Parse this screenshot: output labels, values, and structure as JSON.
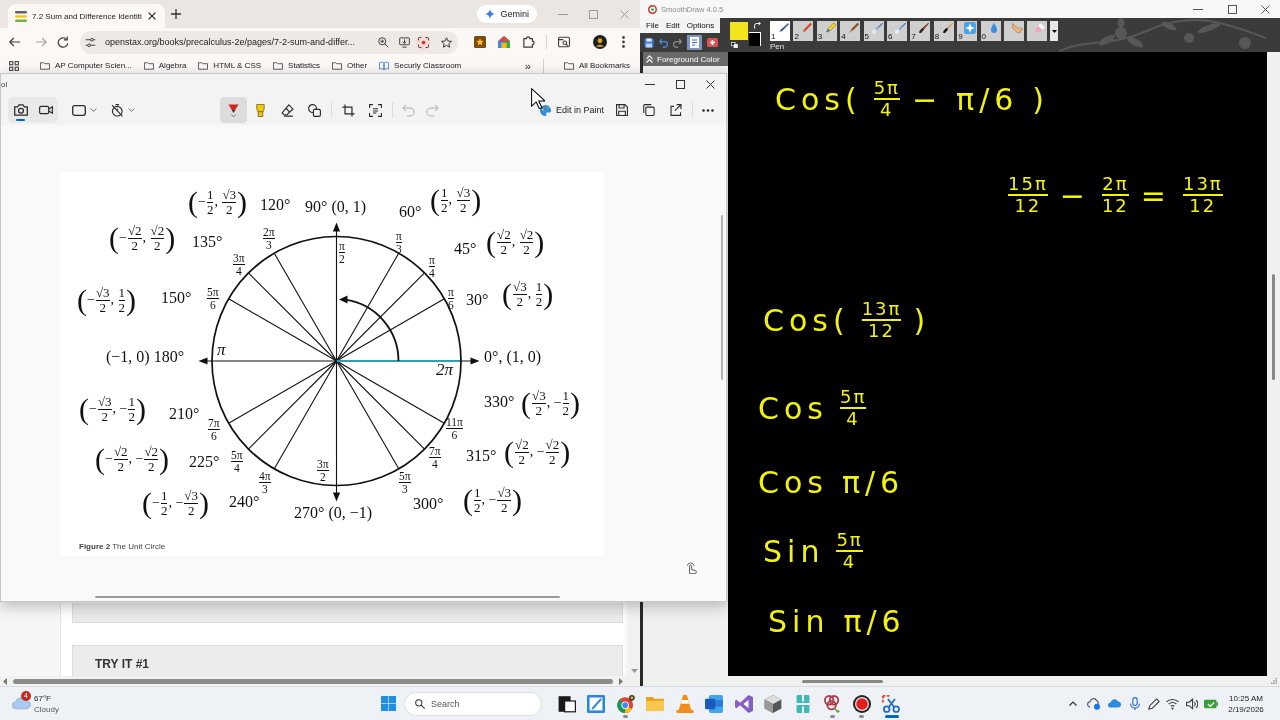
{
  "browser": {
    "tab": {
      "title": "7.2 Sum and Difference Identiti"
    },
    "assistant_button": "Gemini",
    "url": "openstax.org/books/precalculus-2e/pages/7-2-sum-and-differ...",
    "bookmarks": [
      {
        "kind": "folder",
        "label": "AP Computer Scien..."
      },
      {
        "kind": "folder",
        "label": "Algebra"
      },
      {
        "kind": "folder",
        "label": "HTML & CSS"
      },
      {
        "kind": "folder",
        "label": "Statistics"
      },
      {
        "kind": "folder",
        "label": "Other"
      },
      {
        "kind": "site",
        "label": "Securly Classroom"
      }
    ],
    "more_bookmarks": "»",
    "all_bookmarks": "All Bookmarks",
    "page": {
      "box_heading": "TRY IT #1"
    }
  },
  "snipping_tool": {
    "title": "ol",
    "modes": [
      {
        "kind": "photo",
        "selected": true
      },
      {
        "kind": "video",
        "selected": false
      }
    ],
    "tools": [
      {
        "kind": "pen",
        "selected": true
      },
      {
        "kind": "highlighter",
        "selected": false
      },
      {
        "kind": "eraser",
        "selected": false
      },
      {
        "kind": "shapes",
        "selected": false
      }
    ],
    "history": [
      {
        "kind": "undo",
        "disabled": true
      },
      {
        "kind": "redo",
        "disabled": true
      }
    ],
    "edit_in_paint": "Edit in Paint",
    "figure": {
      "labels": [
        {
          "kind": "coordinate",
          "parts": [
            {
              "kind": "paren",
              "text": "("
            },
            {
              "kind": "text",
              "text": "−"
            },
            {
              "kind": "fraction",
              "num": "1",
              "den": "2"
            },
            {
              "kind": "text",
              "text": ", "
            },
            {
              "kind": "fraction",
              "num": "√3",
              "den": "2"
            },
            {
              "kind": "paren",
              "text": ")"
            }
          ]
        },
        {
          "kind": "degree",
          "text": "120°"
        },
        {
          "kind": "degree",
          "text": "90° (0, 1)"
        },
        {
          "kind": "degree",
          "text": "60°"
        },
        {
          "kind": "coordinate",
          "parts": [
            {
              "kind": "paren",
              "text": "("
            },
            {
              "kind": "fraction",
              "num": "1",
              "den": "2"
            },
            {
              "kind": "text",
              "text": ", "
            },
            {
              "kind": "fraction",
              "num": "√3",
              "den": "2"
            },
            {
              "kind": "paren",
              "text": ")"
            }
          ]
        },
        {
          "kind": "coordinate",
          "parts": [
            {
              "kind": "paren",
              "text": "("
            },
            {
              "kind": "text",
              "text": "−"
            },
            {
              "kind": "fraction",
              "num": "√2",
              "den": "2"
            },
            {
              "kind": "text",
              "text": ", "
            },
            {
              "kind": "fraction",
              "num": "√2",
              "den": "2"
            },
            {
              "kind": "paren",
              "text": ")"
            }
          ]
        },
        {
          "kind": "degree",
          "text": "135°"
        },
        {
          "kind": "radian",
          "parts": [
            {
              "kind": "fraction",
              "num": "2π",
              "den": "3"
            }
          ]
        },
        {
          "kind": "radian",
          "parts": [
            {
              "kind": "fraction",
              "num": "π",
              "den": "2"
            }
          ]
        },
        {
          "kind": "radian",
          "parts": [
            {
              "kind": "fraction",
              "num": "π",
              "den": "3"
            }
          ]
        },
        {
          "kind": "radian",
          "parts": [
            {
              "kind": "fraction",
              "num": "π",
              "den": "4"
            }
          ]
        },
        {
          "kind": "degree",
          "text": "45°"
        },
        {
          "kind": "coordinate",
          "parts": [
            {
              "kind": "paren",
              "text": "("
            },
            {
              "kind": "fraction",
              "num": "√2",
              "den": "2"
            },
            {
              "kind": "text",
              "text": ", "
            },
            {
              "kind": "fraction",
              "num": "√2",
              "den": "2"
            },
            {
              "kind": "paren",
              "text": ")"
            }
          ]
        },
        {
          "kind": "radian",
          "parts": [
            {
              "kind": "fraction",
              "num": "3π",
              "den": "4"
            }
          ]
        },
        {
          "kind": "coordinate",
          "parts": [
            {
              "kind": "paren",
              "text": "("
            },
            {
              "kind": "text",
              "text": "−"
            },
            {
              "kind": "fraction",
              "num": "√3",
              "den": "2"
            },
            {
              "kind": "text",
              "text": ", "
            },
            {
              "kind": "fraction",
              "num": "1",
              "den": "2"
            },
            {
              "kind": "paren",
              "text": ")"
            }
          ]
        },
        {
          "kind": "degree",
          "text": "150°"
        },
        {
          "kind": "radian",
          "parts": [
            {
              "kind": "fraction",
              "num": "5π",
              "den": "6"
            }
          ]
        },
        {
          "kind": "radian",
          "parts": [
            {
              "kind": "fraction",
              "num": "π",
              "den": "6"
            }
          ]
        },
        {
          "kind": "degree",
          "text": "30°"
        },
        {
          "kind": "coordinate",
          "parts": [
            {
              "kind": "paren",
              "text": "("
            },
            {
              "kind": "fraction",
              "num": "√3",
              "den": "2"
            },
            {
              "kind": "text",
              "text": ", "
            },
            {
              "kind": "fraction",
              "num": "1",
              "den": "2"
            },
            {
              "kind": "paren",
              "text": ")"
            }
          ]
        },
        {
          "kind": "degree",
          "text": "(−1, 0) 180°"
        },
        {
          "kind": "radian",
          "parts": [
            {
              "kind": "text",
              "text": "π"
            }
          ]
        },
        {
          "kind": "degree",
          "text": "0°, (1, 0)"
        },
        {
          "kind": "radian",
          "parts": [
            {
              "kind": "text",
              "text": "2π"
            }
          ]
        },
        {
          "kind": "coordinate",
          "parts": [
            {
              "kind": "paren",
              "text": "("
            },
            {
              "kind": "text",
              "text": "−"
            },
            {
              "kind": "fraction",
              "num": "√3",
              "den": "2"
            },
            {
              "kind": "text",
              "text": ", −"
            },
            {
              "kind": "fraction",
              "num": "1",
              "den": "2"
            },
            {
              "kind": "paren",
              "text": ")"
            }
          ]
        },
        {
          "kind": "degree",
          "text": "210°"
        },
        {
          "kind": "radian",
          "parts": [
            {
              "kind": "fraction",
              "num": "7π",
              "den": "6"
            }
          ]
        },
        {
          "kind": "degree",
          "text": "330°"
        },
        {
          "kind": "coordinate",
          "parts": [
            {
              "kind": "paren",
              "text": "("
            },
            {
              "kind": "fraction",
              "num": "√3",
              "den": "2"
            },
            {
              "kind": "text",
              "text": ", −"
            },
            {
              "kind": "fraction",
              "num": "1",
              "den": "2"
            },
            {
              "kind": "paren",
              "text": ")"
            }
          ]
        },
        {
          "kind": "radian",
          "parts": [
            {
              "kind": "fraction",
              "num": "11π",
              "den": "6"
            }
          ]
        },
        {
          "kind": "coordinate",
          "parts": [
            {
              "kind": "paren",
              "text": "("
            },
            {
              "kind": "text",
              "text": "−"
            },
            {
              "kind": "fraction",
              "num": "√2",
              "den": "2"
            },
            {
              "kind": "text",
              "text": ", −"
            },
            {
              "kind": "fraction",
              "num": "√2",
              "den": "2"
            },
            {
              "kind": "paren",
              "text": ")"
            }
          ]
        },
        {
          "kind": "degree",
          "text": "225°"
        },
        {
          "kind": "radian",
          "parts": [
            {
              "kind": "fraction",
              "num": "5π",
              "den": "4"
            }
          ]
        },
        {
          "kind": "radian",
          "parts": [
            {
              "kind": "fraction",
              "num": "7π",
              "den": "4"
            }
          ]
        },
        {
          "kind": "degree",
          "text": "315°"
        },
        {
          "kind": "coordinate",
          "parts": [
            {
              "kind": "paren",
              "text": "("
            },
            {
              "kind": "fraction",
              "num": "√2",
              "den": "2"
            },
            {
              "kind": "text",
              "text": ", −"
            },
            {
              "kind": "fraction",
              "num": "√2",
              "den": "2"
            },
            {
              "kind": "paren",
              "text": ")"
            }
          ]
        },
        {
          "kind": "radian",
          "parts": [
            {
              "kind": "fraction",
              "num": "3π",
              "den": "2"
            }
          ]
        },
        {
          "kind": "radian",
          "parts": [
            {
              "kind": "fraction",
              "num": "4π",
              "den": "3"
            }
          ]
        },
        {
          "kind": "radian",
          "parts": [
            {
              "kind": "fraction",
              "num": "5π",
              "den": "3"
            }
          ]
        },
        {
          "kind": "coordinate",
          "parts": [
            {
              "kind": "paren",
              "text": "("
            },
            {
              "kind": "text",
              "text": "−"
            },
            {
              "kind": "fraction",
              "num": "1",
              "den": "2"
            },
            {
              "kind": "text",
              "text": ", −"
            },
            {
              "kind": "fraction",
              "num": "√3",
              "den": "2"
            },
            {
              "kind": "paren",
              "text": ")"
            }
          ]
        },
        {
          "kind": "degree",
          "text": "240°"
        },
        {
          "kind": "degree",
          "text": "270° (0, −1)"
        },
        {
          "kind": "degree",
          "text": "300°"
        },
        {
          "kind": "coordinate",
          "parts": [
            {
              "kind": "paren",
              "text": "("
            },
            {
              "kind": "fraction",
              "num": "1",
              "den": "2"
            },
            {
              "kind": "text",
              "text": ", −"
            },
            {
              "kind": "fraction",
              "num": "√3",
              "den": "2"
            },
            {
              "kind": "paren",
              "text": ")"
            }
          ]
        }
      ],
      "caption": "**Figure 2** The Unit Circle"
    }
  },
  "smoothdraw": {
    "title": "SmoothDraw 4.0.5",
    "menu": [
      "File",
      "Edit",
      "Options"
    ],
    "swatches": [
      {
        "kind": "background",
        "color": "#000000"
      },
      {
        "kind": "foreground",
        "color": "#f2e41c"
      }
    ],
    "brushes": [
      {
        "kind": "pen",
        "key": "1",
        "label": "Pen",
        "selected": true
      },
      {
        "kind": "pencil",
        "key": "2",
        "selected": false
      },
      {
        "kind": "highlighter",
        "key": "3",
        "selected": false
      },
      {
        "kind": "marker",
        "key": "4",
        "selected": false
      },
      {
        "kind": "airbrush",
        "key": "5",
        "selected": false
      },
      {
        "kind": "airbrush",
        "key": "6",
        "selected": false
      },
      {
        "kind": "paintbrush",
        "key": "7",
        "selected": false
      },
      {
        "kind": "brush",
        "key": "8",
        "selected": false
      },
      {
        "kind": "star",
        "key": "9",
        "selected": false
      },
      {
        "kind": "drop",
        "key": "0",
        "selected": false
      },
      {
        "kind": "finger",
        "selected": false
      },
      {
        "kind": "eraser",
        "selected": false
      }
    ],
    "panel_title": "Foreground Color",
    "canvas": {
      "lines": [
        {
          "parts": [
            {
              "kind": "text",
              "text": "Cos("
            },
            {
              "kind": "fraction",
              "num": "5π",
              "den": "4"
            },
            {
              "kind": "text",
              "text": "−"
            },
            {
              "kind": "text",
              "text": "π/6"
            },
            {
              "kind": "text",
              "text": ")"
            }
          ]
        },
        {
          "parts": [
            {
              "kind": "fraction",
              "num": "15π",
              "den": "12"
            },
            {
              "kind": "text",
              "text": "−"
            },
            {
              "kind": "fraction",
              "num": "2π",
              "den": "12"
            },
            {
              "kind": "text",
              "text": "="
            },
            {
              "kind": "fraction",
              "num": "13π",
              "den": "12"
            }
          ]
        },
        {
          "parts": [
            {
              "kind": "text",
              "text": "Cos("
            },
            {
              "kind": "fraction",
              "num": "13π",
              "den": "12"
            },
            {
              "kind": "text",
              "text": ")"
            }
          ]
        },
        {
          "parts": [
            {
              "kind": "text",
              "text": "Cos"
            },
            {
              "kind": "fraction",
              "num": "5π",
              "den": "4"
            }
          ]
        },
        {
          "parts": [
            {
              "kind": "text",
              "text": "Cos"
            },
            {
              "kind": "text",
              "text": "π/6"
            }
          ]
        },
        {
          "parts": [
            {
              "kind": "text",
              "text": "Sin"
            },
            {
              "kind": "fraction",
              "num": "5π",
              "den": "4"
            }
          ]
        },
        {
          "parts": [
            {
              "kind": "text",
              "text": "Sin"
            },
            {
              "kind": "text",
              "text": "π/6"
            }
          ]
        }
      ]
    }
  },
  "taskbar": {
    "weather": {
      "badge": "4",
      "temperature": "67°F",
      "condition": "Cloudy"
    },
    "search": {
      "placeholder": "Search"
    },
    "apps": [
      {
        "kind": "squares",
        "running": false,
        "selected": false
      },
      {
        "kind": "notepad",
        "running": false,
        "selected": false
      },
      {
        "kind": "browser",
        "running": true,
        "selected": false
      },
      {
        "kind": "folder",
        "running": false,
        "selected": false
      },
      {
        "kind": "cone",
        "running": false,
        "selected": false
      },
      {
        "kind": "word",
        "running": false,
        "selected": false
      },
      {
        "kind": "studio",
        "running": false,
        "selected": false
      },
      {
        "kind": "cube",
        "running": false,
        "selected": false
      },
      {
        "kind": "split",
        "running": false,
        "selected": false
      },
      {
        "kind": "flower",
        "running": true,
        "selected": false
      },
      {
        "kind": "record",
        "running": true,
        "selected": false
      },
      {
        "kind": "scissors",
        "running": true,
        "selected": true
      }
    ],
    "time": "10:25 AM",
    "date": "2/19/2026"
  }
}
